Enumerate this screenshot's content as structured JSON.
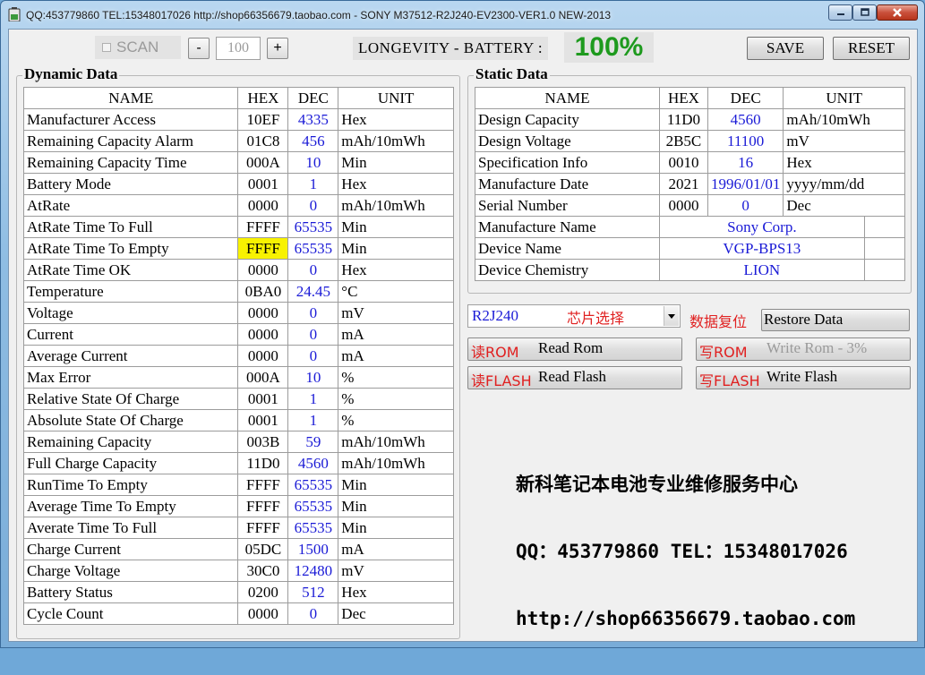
{
  "window": {
    "title": "QQ:453779860 TEL:15348017026 http://shop66356679.taobao.com - SONY M37512-R2J240-EV2300-VER1.0 NEW-2013"
  },
  "toolbar": {
    "scan_label": "SCAN",
    "minus_label": "-",
    "step_value": "100",
    "plus_label": "+",
    "longevity_label": "LONGEVITY - BATTERY :",
    "longevity_value": "100%",
    "save_label": "SAVE",
    "reset_label": "RESET"
  },
  "dynamic": {
    "legend": "Dynamic Data",
    "headers": [
      "NAME",
      "HEX",
      "DEC",
      "UNIT"
    ],
    "rows": [
      {
        "name": "Manufacturer Access",
        "hex": "10EF",
        "dec": "4335",
        "unit": "Hex"
      },
      {
        "name": "Remaining Capacity Alarm",
        "hex": "01C8",
        "dec": "456",
        "unit": "mAh/10mWh"
      },
      {
        "name": "Remaining Capacity Time",
        "hex": "000A",
        "dec": "10",
        "unit": "Min"
      },
      {
        "name": "Battery Mode",
        "hex": "0001",
        "dec": "1",
        "unit": "Hex"
      },
      {
        "name": "AtRate",
        "hex": "0000",
        "dec": "0",
        "unit": "mAh/10mWh"
      },
      {
        "name": "AtRate Time To Full",
        "hex": "FFFF",
        "dec": "65535",
        "unit": "Min"
      },
      {
        "name": "AtRate Time To Empty",
        "hex": "FFFF",
        "dec": "65535",
        "unit": "Min"
      },
      {
        "name": "AtRate Time OK",
        "hex": "0000",
        "dec": "0",
        "unit": "Hex"
      },
      {
        "name": "Temperature",
        "hex": "0BA0",
        "dec": "24.45",
        "unit": "°C"
      },
      {
        "name": "Voltage",
        "hex": "0000",
        "dec": "0",
        "unit": "mV"
      },
      {
        "name": "Current",
        "hex": "0000",
        "dec": "0",
        "unit": "mA"
      },
      {
        "name": "Average Current",
        "hex": "0000",
        "dec": "0",
        "unit": "mA"
      },
      {
        "name": "Max Error",
        "hex": "000A",
        "dec": "10",
        "unit": "%"
      },
      {
        "name": "Relative State Of Charge",
        "hex": "0001",
        "dec": "1",
        "unit": "%"
      },
      {
        "name": "Absolute State Of Charge",
        "hex": "0001",
        "dec": "1",
        "unit": "%"
      },
      {
        "name": "Remaining Capacity",
        "hex": "003B",
        "dec": "59",
        "unit": "mAh/10mWh"
      },
      {
        "name": "Full Charge Capacity",
        "hex": "11D0",
        "dec": "4560",
        "unit": "mAh/10mWh"
      },
      {
        "name": "RunTime To Empty",
        "hex": "FFFF",
        "dec": "65535",
        "unit": "Min"
      },
      {
        "name": "Average Time To Empty",
        "hex": "FFFF",
        "dec": "65535",
        "unit": "Min"
      },
      {
        "name": "Averate Time To Full",
        "hex": "FFFF",
        "dec": "65535",
        "unit": "Min"
      },
      {
        "name": "Charge Current",
        "hex": "05DC",
        "dec": "1500",
        "unit": "mA"
      },
      {
        "name": "Charge Voltage",
        "hex": "30C0",
        "dec": "12480",
        "unit": "mV"
      },
      {
        "name": "Battery Status",
        "hex": "0200",
        "dec": "512",
        "unit": "Hex"
      },
      {
        "name": "Cycle Count",
        "hex": "0000",
        "dec": "0",
        "unit": "Dec"
      }
    ],
    "highlight_color": "#f8f200"
  },
  "static": {
    "legend": "Static Data",
    "headers": [
      "NAME",
      "HEX",
      "DEC",
      "UNIT"
    ],
    "rows": [
      {
        "name": "Design Capacity",
        "hex": "11D0",
        "dec": "4560",
        "unit": "mAh/10mWh"
      },
      {
        "name": "Design Voltage",
        "hex": "2B5C",
        "dec": "11100",
        "unit": "mV"
      },
      {
        "name": "Specification Info",
        "hex": "0010",
        "dec": "16",
        "unit": "Hex"
      },
      {
        "name": "Manufacture Date",
        "hex": "2021",
        "dec": "1996/01/01",
        "unit": "yyyy/mm/dd"
      },
      {
        "name": "Serial Number",
        "hex": "0000",
        "dec": "0",
        "unit": "Dec"
      }
    ],
    "text_rows": [
      {
        "name": "Manufacture Name",
        "value": "Sony Corp."
      },
      {
        "name": "Device Name",
        "value": "VGP-BPS13"
      },
      {
        "name": "Device Chemistry",
        "value": "LION"
      }
    ]
  },
  "chip": {
    "selected": "R2J240",
    "hint": "芯片选择",
    "restore_cn": "数据复位",
    "restore_label": "Restore Data"
  },
  "actions": {
    "read_rom_cn": "读ROM",
    "read_rom": "Read Rom",
    "write_rom_cn": "写ROM",
    "write_rom": "Write Rom - 3%",
    "read_flash_cn": "读FLASH",
    "read_flash": "Read Flash",
    "write_flash_cn": "写FLASH",
    "write_flash": "Write Flash"
  },
  "info": {
    "line1": "新科笔记本电池专业维修服务中心",
    "line2": "QQ：453779860 TEL：15348017026",
    "line3": "http://shop66356679.taobao.com"
  },
  "colors": {
    "value_blue": "#1a1ad6",
    "cn_red": "#e02020",
    "percent_green": "#1e9a1e"
  },
  "icons": {
    "app": "battery-icon",
    "minimize": "minimize-icon",
    "maximize": "maximize-icon",
    "close": "close-icon",
    "dropdown": "chevron-down-icon"
  }
}
